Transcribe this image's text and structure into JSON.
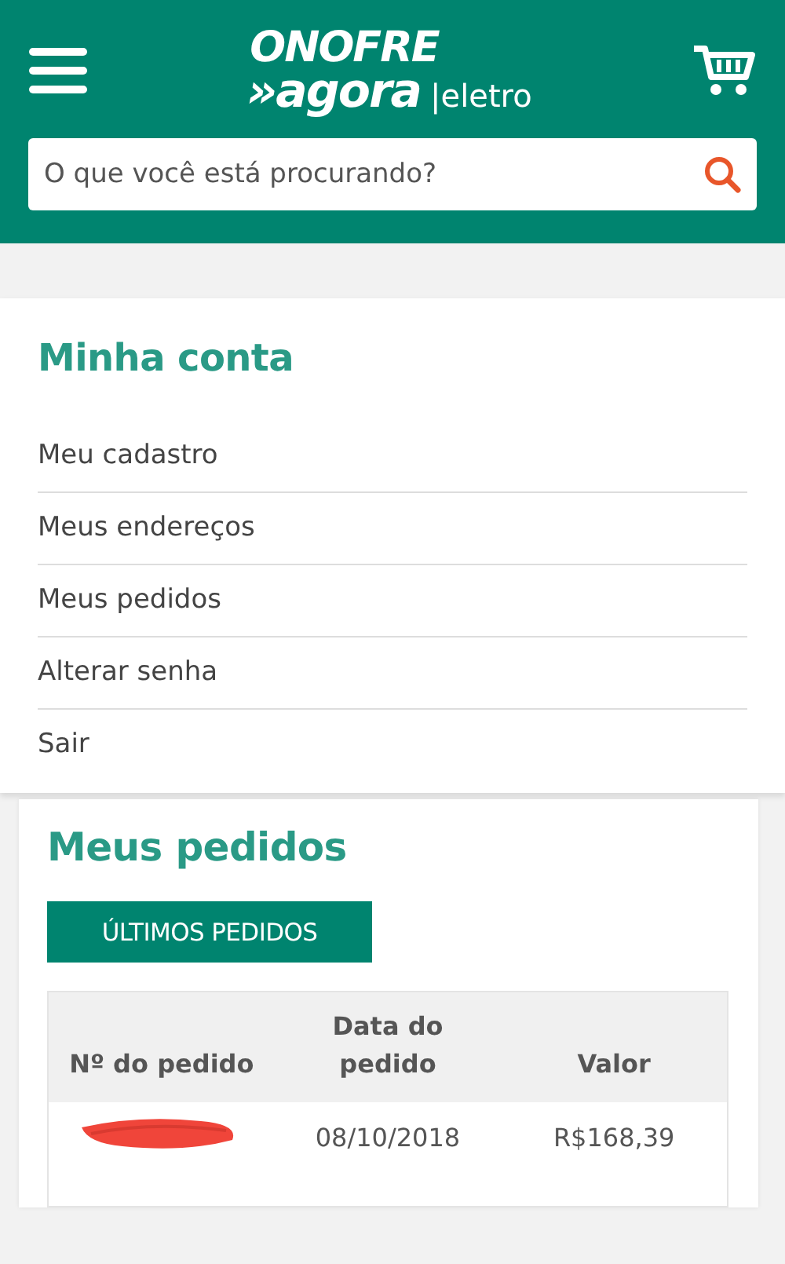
{
  "header": {
    "logo": {
      "line_1": "ONOFRE",
      "line_2": "»agora",
      "suffix": "|eletro"
    },
    "search": {
      "placeholder": "O que você está procurando?"
    }
  },
  "account_menu": {
    "title": "Minha conta",
    "items": [
      {
        "label": "Meu cadastro"
      },
      {
        "label": "Meus endereços"
      },
      {
        "label": "Meus pedidos"
      },
      {
        "label": "Alterar senha"
      },
      {
        "label": "Sair"
      }
    ]
  },
  "orders": {
    "title": "Meus pedidos",
    "tab": "ÚLTIMOS PEDIDOS",
    "table": {
      "columns": [
        "Nº do pedido",
        "Data do pedido",
        "Valor"
      ],
      "rows": [
        {
          "order_number": {
            "kind": "redacted"
          },
          "date": "08/10/2018",
          "value": "R$168,39"
        }
      ]
    }
  }
}
